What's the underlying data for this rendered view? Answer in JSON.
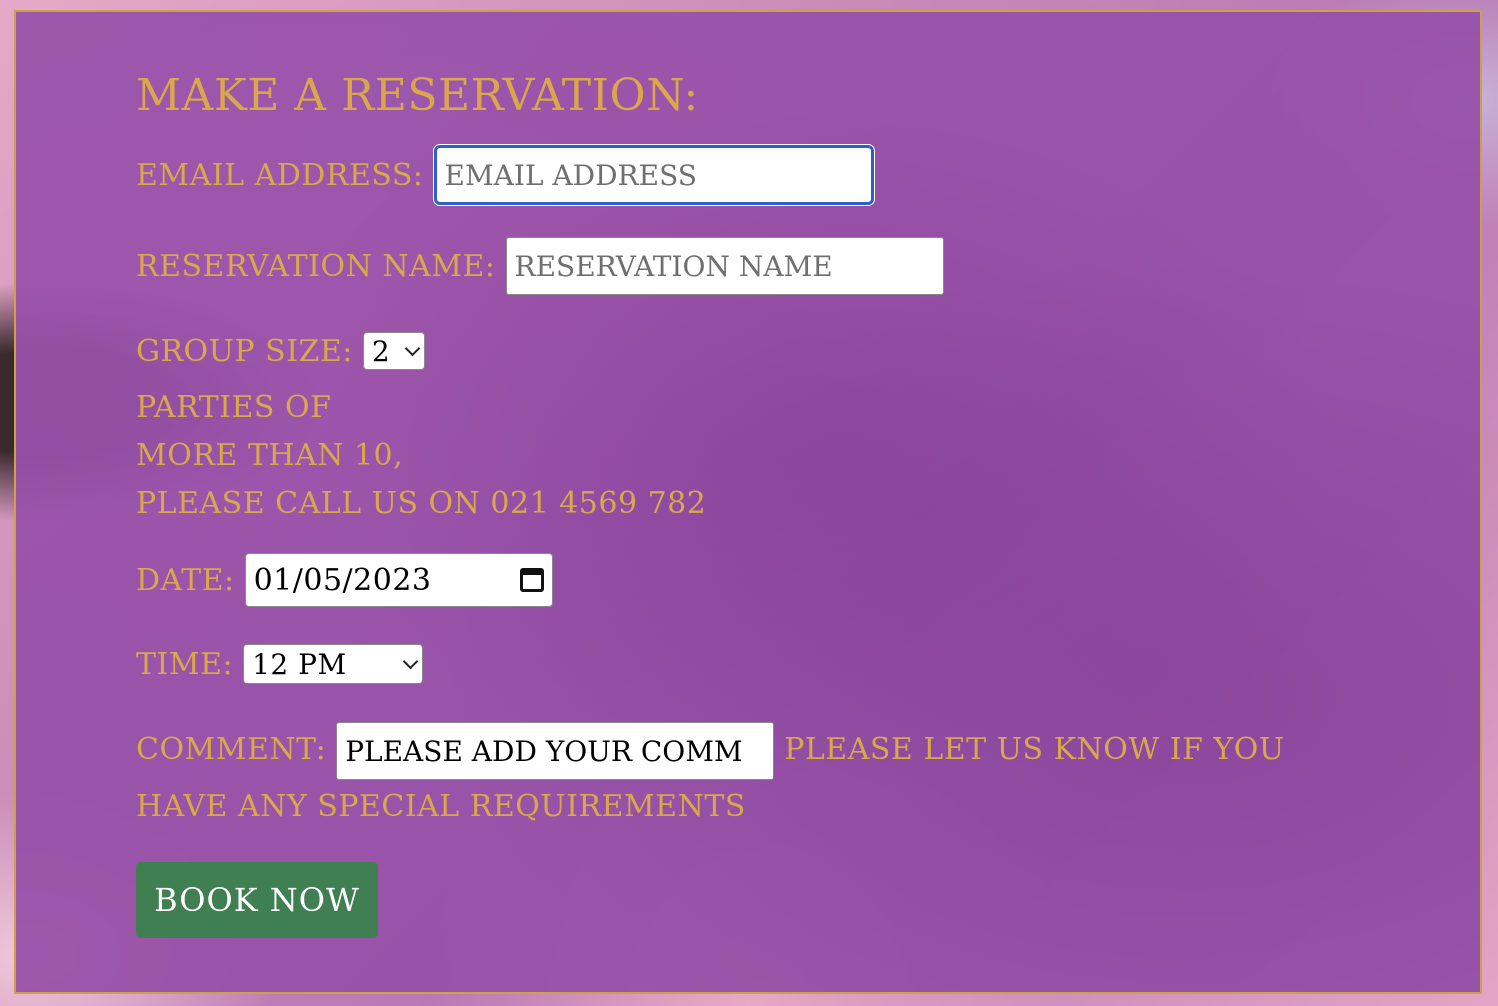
{
  "form": {
    "title": "MAKE A RESERVATION:",
    "email": {
      "label": "EMAIL ADDRESS:",
      "placeholder": "EMAIL ADDRESS"
    },
    "reservation_name": {
      "label": "RESERVATION NAME:",
      "placeholder": "RESERVATION NAME"
    },
    "group_size": {
      "label": "GROUP SIZE:",
      "selected": "2"
    },
    "large_party_note": [
      "PARTIES OF",
      "MORE THAN 10,",
      "PLEASE CALL US ON 021 4569 782"
    ],
    "date": {
      "label": "DATE:",
      "value": "01/05/2023"
    },
    "time": {
      "label": "TIME:",
      "selected": "12 PM"
    },
    "comment": {
      "label": "COMMENT:",
      "placeholder": "PLEASE ADD YOUR COMM",
      "hint": "PLEASE LET US KNOW IF YOU HAVE ANY SPECIAL REQUIREMENTS"
    },
    "submit_label": "BOOK NOW"
  },
  "colors": {
    "panel_bg": "#9650a8",
    "accent_gold": "#d8a84a",
    "button_green": "#3f7f52",
    "focus_blue": "#2f5fc9"
  }
}
